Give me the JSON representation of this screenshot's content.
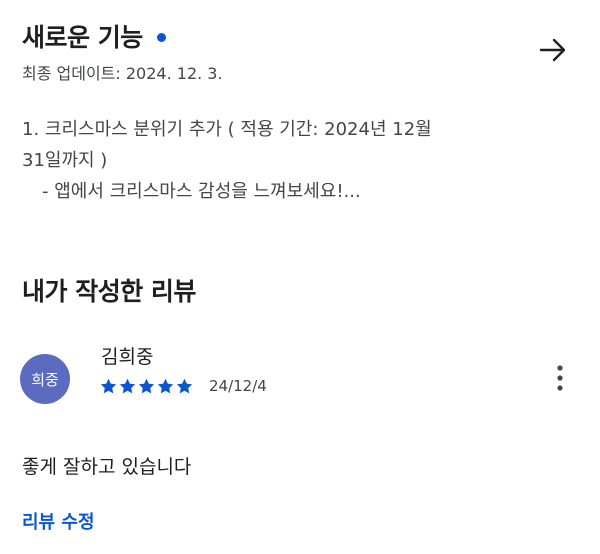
{
  "whats_new": {
    "title": "새로운 기능",
    "updated": "최종 업데이트: 2024. 12. 3.",
    "notes": {
      "line1": "1. 크리스마스 분위기 추가 ( 적용 기간: 2024년 12월",
      "line2": "31일까지 )",
      "line3": "- 앱에서 크리스마스 감성을 느껴보세요!..."
    },
    "arrow_icon": "arrow-right-icon",
    "new_indicator_icon": "dot-icon"
  },
  "my_review": {
    "heading": "내가 작성한 리뷰",
    "avatar_text": "희중",
    "reviewer": "김희중",
    "rating": 5,
    "max_rating": 5,
    "date": "24/12/4",
    "text": "좋게 잘하고 있습니다",
    "edit_label": "리뷰 수정",
    "more_icon": "more-vert-icon",
    "star_icon": "star-icon"
  },
  "colors": {
    "accent": "#0b57d0",
    "star": "#0b57d0",
    "avatar_bg": "#5c6bc0",
    "dot": "#0b57d0",
    "text_primary": "#1f1f1f",
    "text_secondary": "#444746"
  }
}
